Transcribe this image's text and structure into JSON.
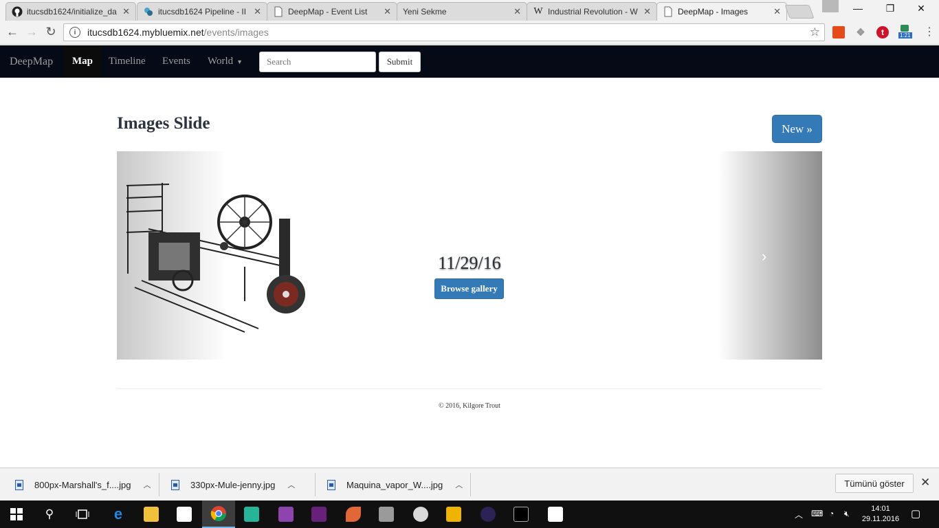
{
  "browser": {
    "tabs": [
      {
        "label": "itucsdb1624/initialize_da",
        "icon": "github-icon",
        "active": false
      },
      {
        "label": "itucsdb1624 Pipeline - II",
        "icon": "bluemix-icon",
        "active": false
      },
      {
        "label": "DeepMap - Event List",
        "icon": "page-icon",
        "active": false
      },
      {
        "label": "Yeni Sekme",
        "icon": "none",
        "active": false
      },
      {
        "label": "Industrial Revolution - W",
        "icon": "wikipedia-icon",
        "active": false
      },
      {
        "label": "DeepMap - Images",
        "icon": "page-icon",
        "active": true
      }
    ],
    "url_host": "itucsdb1624.mybluemix.net",
    "url_path": "/events/images",
    "extension_badge": "1:21"
  },
  "site": {
    "brand": "DeepMap",
    "nav": [
      "Map",
      "Timeline",
      "Events",
      "World"
    ],
    "active_nav": "Map",
    "search_placeholder": "Search",
    "submit_label": "Submit"
  },
  "page": {
    "title": "Images Slide",
    "new_button": "New »",
    "slide": {
      "caption": "11/29/16",
      "button": "Browse gallery",
      "next_icon": "›"
    },
    "footer": "© 2016, Kilgore Trout"
  },
  "downloads": {
    "items": [
      "800px-Marshall's_f....jpg",
      "330px-Mule-jenny.jpg",
      "Maquina_vapor_W....jpg"
    ],
    "show_all": "Tümünü göster"
  },
  "taskbar": {
    "time": "14:01",
    "date": "29.11.2016",
    "accent": "#76b9ed"
  }
}
